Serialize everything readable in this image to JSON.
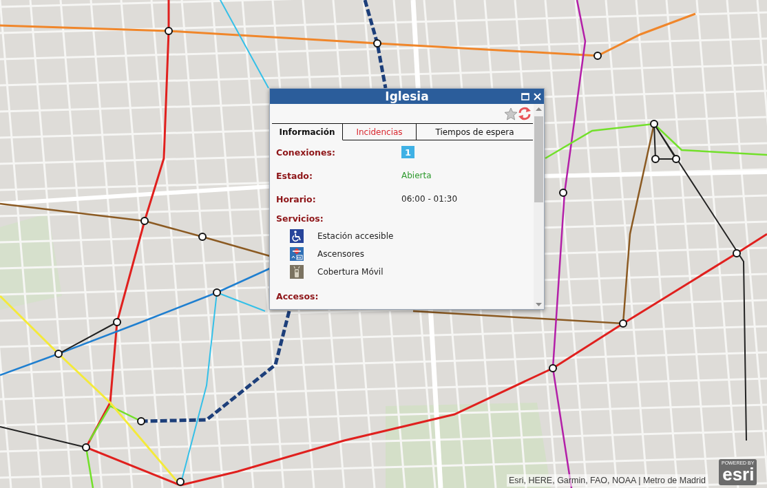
{
  "map": {
    "attribution": "Esri, HERE, Garmin, FAO, NOAA | Metro de Madrid",
    "logo": {
      "caption": "POWERED BY",
      "name": "esri"
    }
  },
  "popup": {
    "title": "Iglesia",
    "tabs": [
      {
        "label": "Información",
        "selected": true,
        "color": "#111111"
      },
      {
        "label": "Incidencias",
        "selected": false,
        "color": "#d9262e"
      },
      {
        "label": "Tiempos de espera",
        "selected": false,
        "color": "#111111"
      }
    ],
    "fields": [
      {
        "kind": "lines",
        "label": "Conexiones:",
        "lines": [
          {
            "label": "1",
            "color": "#3fb1e5"
          }
        ]
      },
      {
        "kind": "status",
        "label": "Estado:",
        "value": "Abierta",
        "open": true
      },
      {
        "kind": "text",
        "label": "Horario:",
        "value": "06:00 - 01:30"
      },
      {
        "kind": "services",
        "label": "Servicios:",
        "items": [
          {
            "kind": "accessible",
            "label": "Estación accesible"
          },
          {
            "kind": "elevator",
            "label": "Ascensores"
          },
          {
            "kind": "mobile",
            "label": "Cobertura Móvil"
          }
        ]
      },
      {
        "kind": "heading",
        "label": "Accesos:"
      }
    ]
  }
}
